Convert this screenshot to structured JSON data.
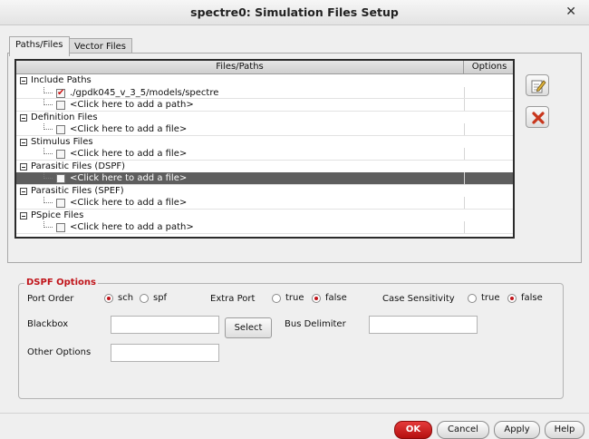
{
  "window": {
    "title": "spectre0: Simulation Files Setup"
  },
  "tabs": [
    {
      "label": "Paths/Files",
      "active": true
    },
    {
      "label": "Vector Files",
      "active": false
    }
  ],
  "tree": {
    "columns": {
      "files": "Files/Paths",
      "options": "Options"
    },
    "categories": [
      {
        "label": "Include Paths",
        "items": [
          {
            "label": "./gpdk045_v_3_5/models/spectre",
            "checked": true
          },
          {
            "label": "<Click here to add a path>",
            "checked": false
          }
        ]
      },
      {
        "label": "Definition Files",
        "items": [
          {
            "label": "<Click here to add a file>",
            "checked": false
          }
        ]
      },
      {
        "label": "Stimulus Files",
        "items": [
          {
            "label": "<Click here to add a file>",
            "checked": false
          }
        ]
      },
      {
        "label": "Parasitic Files (DSPF)",
        "items": [
          {
            "label": "<Click here to add a file>",
            "checked": false,
            "selected": true
          }
        ]
      },
      {
        "label": "Parasitic Files (SPEF)",
        "items": [
          {
            "label": "<Click here to add a file>",
            "checked": false
          }
        ]
      },
      {
        "label": "PSpice Files",
        "items": [
          {
            "label": "<Click here to add a path>",
            "checked": false
          }
        ]
      }
    ]
  },
  "dspf": {
    "legend": "DSPF Options",
    "port_order": {
      "label": "Port Order",
      "opt1": "sch",
      "opt2": "spf",
      "selected": "sch"
    },
    "extra_port": {
      "label": "Extra Port",
      "opt1": "true",
      "opt2": "false",
      "selected": "false"
    },
    "case_sensitivity": {
      "label": "Case Sensitivity",
      "opt1": "true",
      "opt2": "false",
      "selected": "false"
    },
    "blackbox": {
      "label": "Blackbox",
      "value": ""
    },
    "select_label": "Select",
    "bus_delimiter": {
      "label": "Bus Delimiter",
      "value": ""
    },
    "other_options": {
      "label": "Other Options",
      "value": ""
    }
  },
  "footer": {
    "ok": "OK",
    "cancel": "Cancel",
    "apply": "Apply",
    "help": "Help"
  },
  "colors": {
    "accent": "#c0141a",
    "selected_row": "#5e5e5e"
  }
}
